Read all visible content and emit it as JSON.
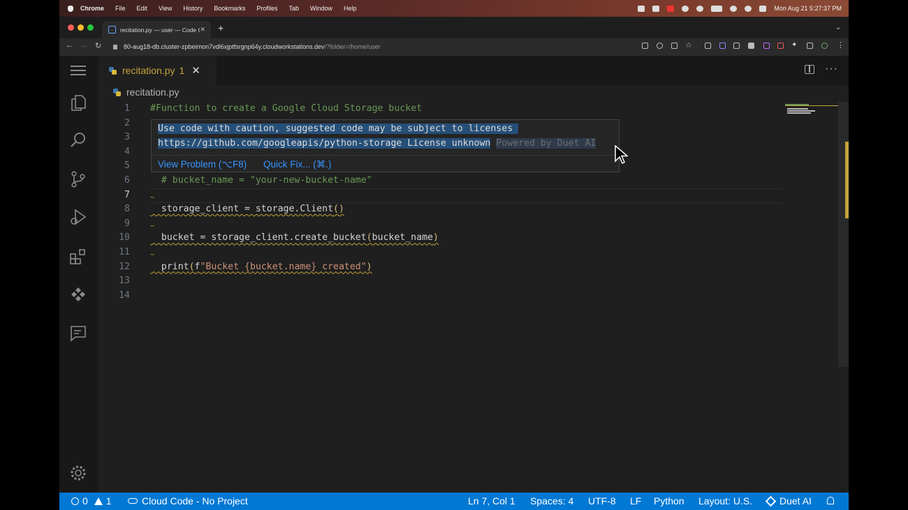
{
  "menubar": {
    "menus": [
      "Chrome",
      "File",
      "Edit",
      "View",
      "History",
      "Bookmarks",
      "Profiles",
      "Tab",
      "Window",
      "Help"
    ],
    "clock": "Mon Aug 21  5:27:37 PM"
  },
  "browser": {
    "tab_title": "recitation.py — user — Code O",
    "url_host": "80-aug18-db.cluster-zpbeimon7vdl6xjptfsrgnp64y.cloudworkstations.dev",
    "url_path": "/?folder=/home/user"
  },
  "editor": {
    "tab_filename": "recitation.py",
    "tab_problem_count": "1",
    "breadcrumb": "recitation.py",
    "lines": [
      {
        "n": "1",
        "text": "#Function to create a Google Cloud Storage bucket"
      },
      {
        "n": "2"
      },
      {
        "n": "3"
      },
      {
        "n": "4"
      },
      {
        "n": "5"
      },
      {
        "n": "6",
        "text": "  # bucket_name = \"your-new-bucket-name\""
      },
      {
        "n": "7"
      },
      {
        "n": "8",
        "text": "  storage_client = storage.Client()"
      },
      {
        "n": "9"
      },
      {
        "n": "10",
        "text": "  bucket = storage_client.create_bucket(bucket_name)"
      },
      {
        "n": "11"
      },
      {
        "n": "12",
        "text": "  print(f\"Bucket {bucket.name} created\")"
      },
      {
        "n": "13"
      },
      {
        "n": "14"
      }
    ]
  },
  "hover": {
    "line1": "Use code with caution, suggested code may be subject to licenses",
    "line2": "https://github.com/googleapis/python-storage License unknown",
    "powered": "Powered by Duet AI",
    "view_problem": "View Problem (⌥F8)",
    "quick_fix": "Quick Fix... (⌘.)"
  },
  "statusbar": {
    "errors": "0",
    "warnings": "1",
    "cloud": "Cloud Code - No Project",
    "position": "Ln 7, Col 1",
    "spaces": "Spaces: 4",
    "encoding": "UTF-8",
    "eol": "LF",
    "language": "Python",
    "layout": "Layout: U.S.",
    "duet": "Duet AI"
  },
  "colors": {
    "accent": "#0078d4",
    "warning": "#c5a33a",
    "link": "#3794ff",
    "selection": "#264f78"
  }
}
